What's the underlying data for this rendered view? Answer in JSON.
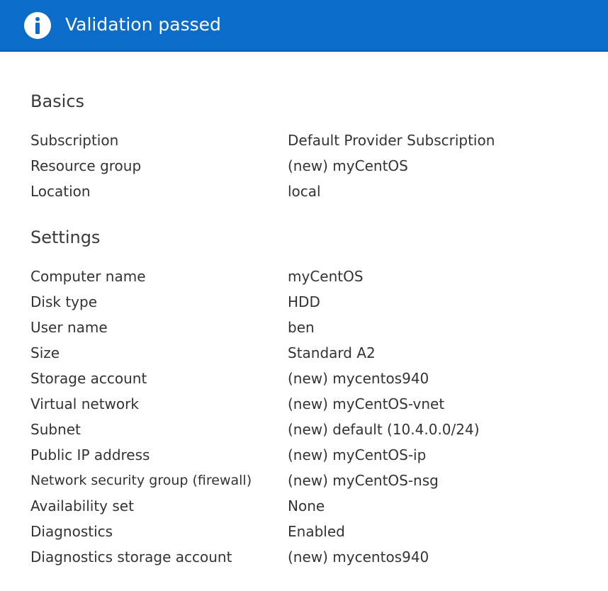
{
  "banner": {
    "title": "Validation passed",
    "icon": "info-icon",
    "background_color": "#0b6cc9"
  },
  "basics": {
    "title": "Basics",
    "rows": [
      {
        "label": "Subscription",
        "value": "Default Provider Subscription"
      },
      {
        "label": "Resource group",
        "value": "(new) myCentOS"
      },
      {
        "label": "Location",
        "value": "local"
      }
    ]
  },
  "settings": {
    "title": "Settings",
    "rows": [
      {
        "label": "Computer name",
        "value": "myCentOS"
      },
      {
        "label": "Disk type",
        "value": "HDD"
      },
      {
        "label": "User name",
        "value": "ben"
      },
      {
        "label": "Size",
        "value": "Standard A2"
      },
      {
        "label": "Storage account",
        "value": "(new) mycentos940"
      },
      {
        "label": "Virtual network",
        "value": "(new) myCentOS-vnet"
      },
      {
        "label": "Subnet",
        "value": "(new) default (10.4.0.0/24)"
      },
      {
        "label": "Public IP address",
        "value": "(new) myCentOS-ip"
      },
      {
        "label": "Network security group (firewall)",
        "value": "(new) myCentOS-nsg"
      },
      {
        "label": "Availability set",
        "value": "None"
      },
      {
        "label": "Diagnostics",
        "value": "Enabled"
      },
      {
        "label": "Diagnostics storage account",
        "value": "(new) mycentos940"
      }
    ]
  }
}
